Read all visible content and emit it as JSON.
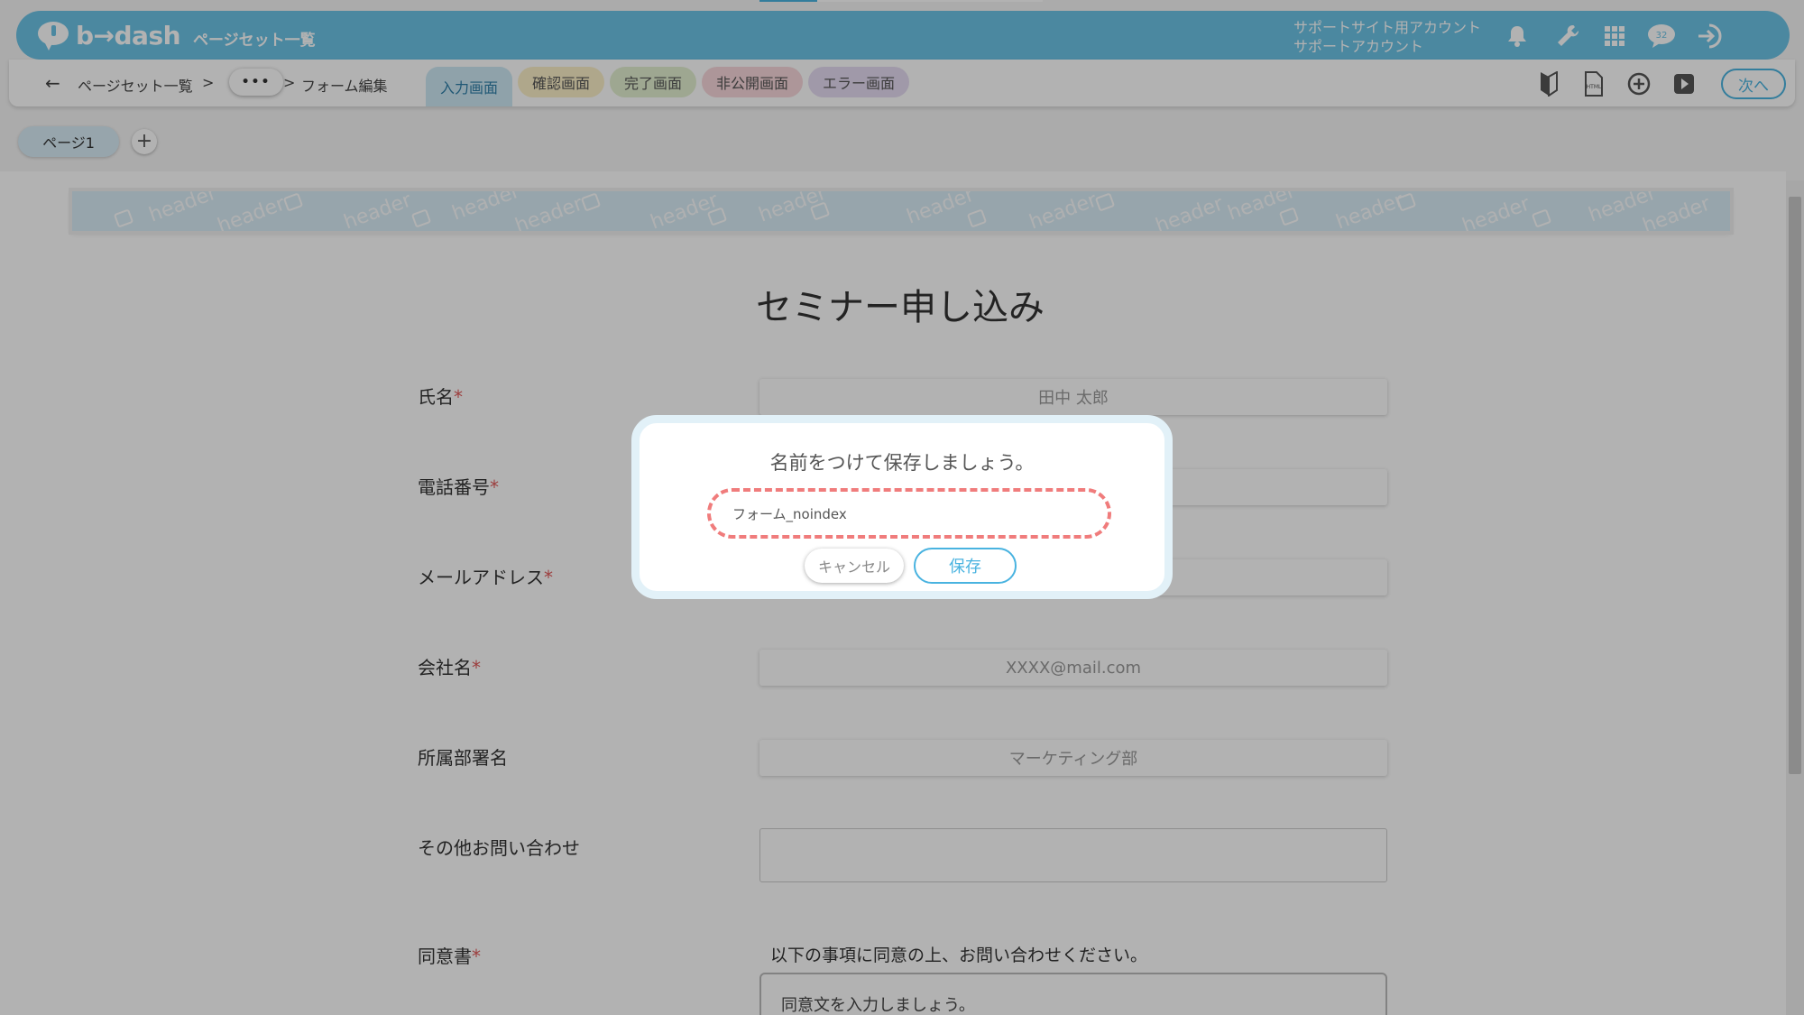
{
  "header": {
    "logo_text": "b→dash",
    "title": "ページセット一覧",
    "account_line1": "サポートサイト用アカウント",
    "account_line2": "サポートアカウント",
    "notification_count": "32"
  },
  "breadcrumb": {
    "item1": "ページセット一覧",
    "sep": ">",
    "more": "•••",
    "item3": "フォーム編集"
  },
  "tabs": [
    "入力画面",
    "確認画面",
    "完了画面",
    "非公開画面",
    "エラー画面"
  ],
  "next_label": "次へ",
  "page_tab": "ページ1",
  "page_add": "+",
  "banner_word": "header",
  "form": {
    "title": "セミナー申し込み",
    "fields": [
      {
        "label": "氏名",
        "required": "*",
        "placeholder": "田中 太郎"
      },
      {
        "label": "電話番号",
        "required": "*",
        "placeholder": ""
      },
      {
        "label": "メールアドレス",
        "required": "*",
        "placeholder": ""
      },
      {
        "label": "会社名",
        "required": "*",
        "placeholder": "XXXX@mail.com"
      },
      {
        "label": "所属部署名",
        "required": "",
        "placeholder": "マーケティング部"
      },
      {
        "label": "その他お問い合わせ",
        "required": "",
        "placeholder": ""
      },
      {
        "label": "同意書",
        "required": "*",
        "placeholder": ""
      }
    ],
    "consent_text": "以下の事項に同意の上、お問い合わせください。",
    "consent_box": "同意文を入力しましょう。"
  },
  "modal": {
    "title": "名前をつけて保存しましょう。",
    "input_value": "フォーム_noindex",
    "cancel_label": "キャンセル",
    "save_label": "保存"
  },
  "colors": {
    "brand": "#6cc3e6",
    "accent": "#49b3e0",
    "highlight_dash": "#f07c7c",
    "required": "#e05a5a"
  }
}
